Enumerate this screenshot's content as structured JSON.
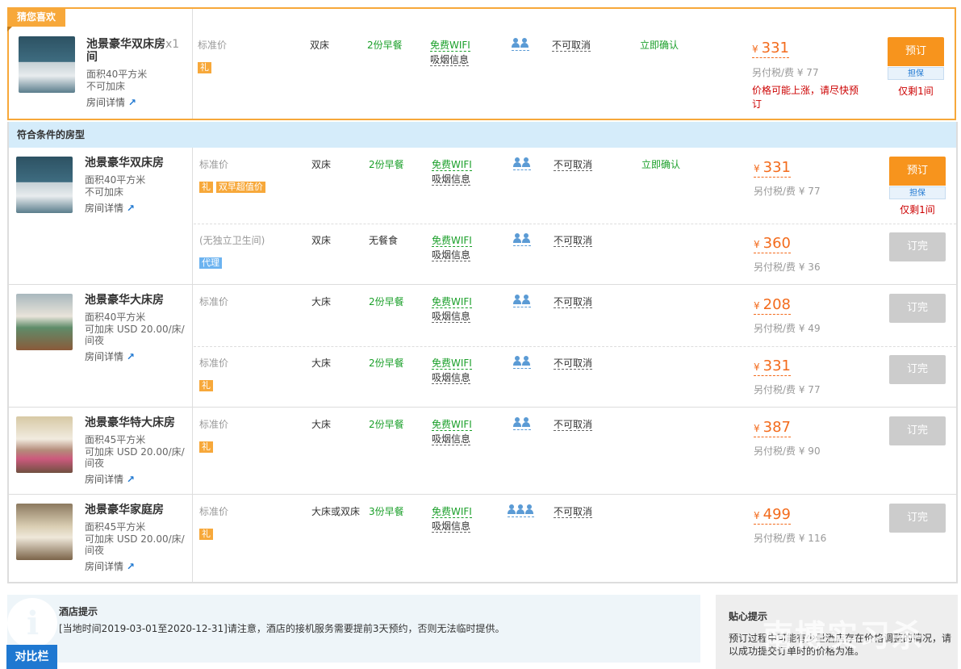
{
  "guess": {
    "tag": "猜您喜欢",
    "room_name": "池景豪华双床房",
    "mult": "x1",
    "unit": "间",
    "area": "面积40平方米",
    "extra": "不可加床",
    "detail": "房间详情",
    "rate": "标准价",
    "gift": "礼",
    "bed": "双床",
    "breakfast": "2份早餐",
    "wifi": "免费WIFI",
    "smoke": "吸烟信息",
    "cancel": "不可取消",
    "confirm": "立即确认",
    "currency": "¥",
    "price": "331",
    "tax": "另付税/费 ¥ 77",
    "warn": "价格可能上涨，请尽快预订",
    "book": "预订",
    "guarantee": "担保",
    "left": "仅剩1间"
  },
  "list_header": "符合条件的房型",
  "rooms": [
    {
      "name": "池景豪华双床房",
      "area": "面积40平方米",
      "extra": "不可加床",
      "detail": "房间详情",
      "rates": [
        {
          "rate": "标准价",
          "gift": "礼",
          "promo": "双早超值价",
          "bed": "双床",
          "breakfast": "2份早餐",
          "wifi": "免费WIFI",
          "smoke": "吸烟信息",
          "cancel": "不可取消",
          "confirm": "立即确认",
          "currency": "¥",
          "price": "331",
          "tax": "另付税/费 ¥ 77",
          "book": "预订",
          "guarantee": "担保",
          "left": "仅剩1间"
        },
        {
          "rate": "(无独立卫生间)",
          "agent": "代理",
          "bed": "双床",
          "breakfast": "无餐食",
          "wifi": "免费WIFI",
          "smoke": "吸烟信息",
          "cancel": "不可取消",
          "currency": "¥",
          "price": "360",
          "tax": "另付税/费 ¥ 36",
          "full": "订完"
        }
      ]
    },
    {
      "name": "池景豪华大床房",
      "area": "面积40平方米",
      "extra": "可加床 USD 20.00/床/间夜",
      "detail": "房间详情",
      "rates": [
        {
          "rate": "标准价",
          "bed": "大床",
          "breakfast": "2份早餐",
          "wifi": "免费WIFI",
          "smoke": "吸烟信息",
          "cancel": "不可取消",
          "currency": "¥",
          "price": "208",
          "tax": "另付税/费 ¥ 49",
          "full": "订完"
        },
        {
          "rate": "标准价",
          "gift": "礼",
          "bed": "大床",
          "breakfast": "2份早餐",
          "wifi": "免费WIFI",
          "smoke": "吸烟信息",
          "cancel": "不可取消",
          "currency": "¥",
          "price": "331",
          "tax": "另付税/费 ¥ 77",
          "full": "订完"
        }
      ]
    },
    {
      "name": "池景豪华特大床房",
      "area": "面积45平方米",
      "extra": "可加床 USD 20.00/床/间夜",
      "detail": "房间详情",
      "rates": [
        {
          "rate": "标准价",
          "gift": "礼",
          "bed": "大床",
          "breakfast": "2份早餐",
          "wifi": "免费WIFI",
          "smoke": "吸烟信息",
          "cancel": "不可取消",
          "currency": "¥",
          "price": "387",
          "tax": "另付税/费 ¥ 90",
          "full": "订完"
        }
      ]
    },
    {
      "name": "池景豪华家庭房",
      "area": "面积45平方米",
      "extra": "可加床 USD 20.00/床/间夜",
      "detail": "房间详情",
      "rates": [
        {
          "rate": "标准价",
          "gift": "礼",
          "bed": "大床或双床",
          "breakfast": "3份早餐",
          "wifi": "免费WIFI",
          "smoke": "吸烟信息",
          "cancel": "不可取消",
          "currency": "¥",
          "price": "499",
          "tax": "另付税/费 ¥ 116",
          "full": "订完"
        }
      ]
    }
  ],
  "hotel_tip": {
    "title": "酒店提示",
    "text": "[当地时间2019-03-01至2020-12-31]请注意，酒店的接机服务需要提前3天预约，否则无法临时提供。"
  },
  "compare": "对比栏",
  "care_tip": {
    "title": "贴心提示",
    "text": "预订过程中可能有少量酒店存在价格调整的情况，请以成功提交订单时的价格为准。"
  },
  "watermark": "南博实习杀"
}
